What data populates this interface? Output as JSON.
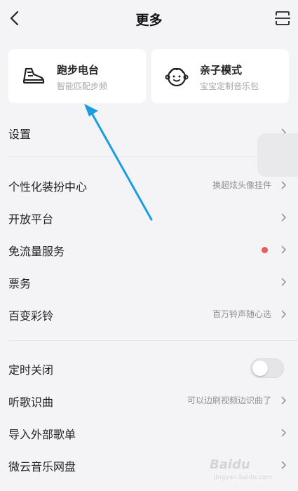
{
  "header": {
    "title": "更多",
    "back_icon": "chevron-left-icon",
    "scan_icon": "scan-icon"
  },
  "cards": [
    {
      "title": "跑步电台",
      "subtitle": "智能匹配步频",
      "icon": "running-shoe-icon"
    },
    {
      "title": "亲子模式",
      "subtitle": "宝宝定制音乐包",
      "icon": "baby-face-icon"
    }
  ],
  "settings": {
    "label": "设置"
  },
  "group1": [
    {
      "label": "个性化装扮中心",
      "hint": "换超炫头像挂件"
    },
    {
      "label": "开放平台",
      "hint": ""
    },
    {
      "label": "免流量服务",
      "hint": ""
    },
    {
      "label": "票务",
      "hint": ""
    },
    {
      "label": "百变彩铃",
      "hint": "百万铃声随心选"
    }
  ],
  "group2": [
    {
      "label": "定时关闭"
    },
    {
      "label": "听歌识曲",
      "hint": "可以边刷视频边识曲了"
    },
    {
      "label": "导入外部歌单"
    },
    {
      "label": "微云音乐网盘"
    }
  ],
  "timer_toggle": {
    "on": false
  },
  "notification_dot_color": "#ec5b5b",
  "annotation_color": "#1a9ee0",
  "watermark": {
    "logo": "Baidu",
    "sub": "jingyan.baidu.com"
  }
}
